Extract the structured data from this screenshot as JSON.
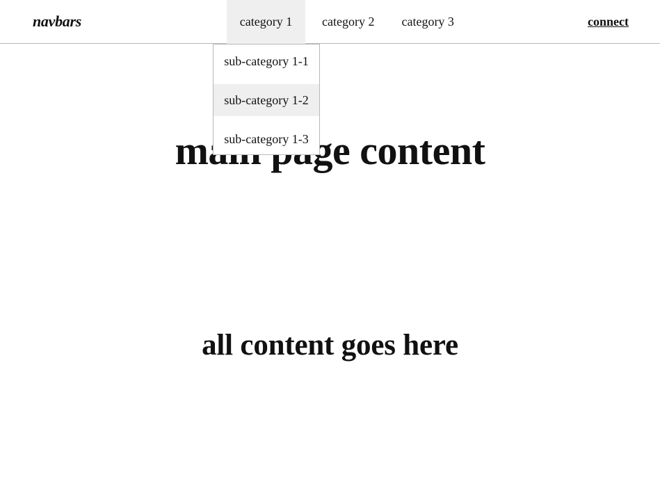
{
  "brand": {
    "name": "navbars"
  },
  "nav": {
    "items": [
      {
        "label": "category 1"
      },
      {
        "label": "category 2"
      },
      {
        "label": "category 3"
      }
    ],
    "connect_label": "connect"
  },
  "dropdown": {
    "items": [
      {
        "label": "sub-category 1-1"
      },
      {
        "label": "sub-category 1-2"
      },
      {
        "label": "sub-category 1-3"
      }
    ]
  },
  "main": {
    "title": "main page content",
    "subtitle": "all content goes here"
  },
  "colors": {
    "active_bg": "#efefef",
    "border": "#b8b8b8",
    "text": "#111111",
    "background": "#ffffff"
  }
}
